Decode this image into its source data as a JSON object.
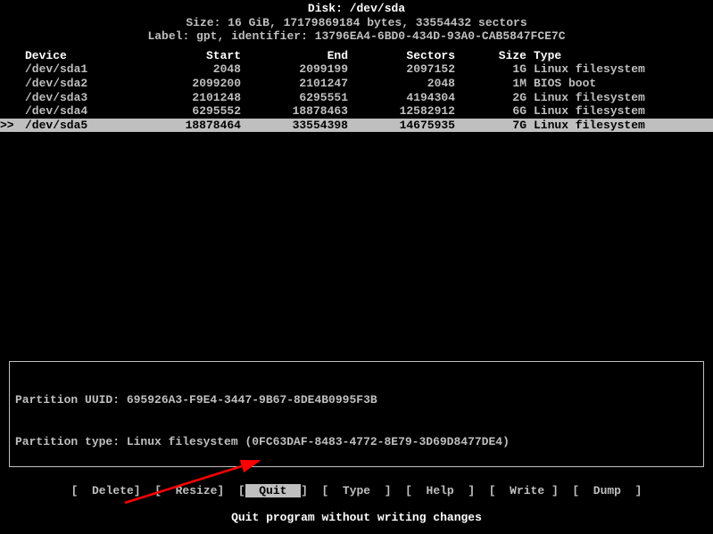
{
  "header": {
    "disk_line": "Disk: /dev/sda",
    "size_line": "Size: 16 GiB, 17179869184 bytes, 33554432 sectors",
    "label_line": "Label: gpt, identifier: 13796EA4-6BD0-434D-93A0-CAB5847FCE7C"
  },
  "columns": {
    "device": "Device",
    "start": "Start",
    "end": "End",
    "sectors": "Sectors",
    "size": "Size",
    "type": "Type"
  },
  "partitions": [
    {
      "device": "/dev/sda1",
      "start": "2048",
      "end": "2099199",
      "sectors": "2097152",
      "size": "1G",
      "type": "Linux filesystem",
      "selected": false
    },
    {
      "device": "/dev/sda2",
      "start": "2099200",
      "end": "2101247",
      "sectors": "2048",
      "size": "1M",
      "type": "BIOS boot",
      "selected": false
    },
    {
      "device": "/dev/sda3",
      "start": "2101248",
      "end": "6295551",
      "sectors": "4194304",
      "size": "2G",
      "type": "Linux filesystem",
      "selected": false
    },
    {
      "device": "/dev/sda4",
      "start": "6295552",
      "end": "18878463",
      "sectors": "12582912",
      "size": "6G",
      "type": "Linux filesystem",
      "selected": false
    },
    {
      "device": "/dev/sda5",
      "start": "18878464",
      "end": "33554398",
      "sectors": "14675935",
      "size": "7G",
      "type": "Linux filesystem",
      "selected": true
    }
  ],
  "info": {
    "uuid_line": "Partition UUID: 695926A3-F9E4-3447-9B67-8DE4B0995F3B",
    "type_line": "Partition type: Linux filesystem (0FC63DAF-8483-4772-8E79-3D69D8477DE4)"
  },
  "menu": [
    {
      "label": "Delete",
      "selected": false
    },
    {
      "label": "Resize",
      "selected": false
    },
    {
      "label": "Quit",
      "selected": true
    },
    {
      "label": "Type",
      "selected": false
    },
    {
      "label": "Help",
      "selected": false
    },
    {
      "label": "Write",
      "selected": false
    },
    {
      "label": "Dump",
      "selected": false
    }
  ],
  "hint": "Quit program without writing changes",
  "annotation": {
    "arrow_color": "#ff0000"
  }
}
